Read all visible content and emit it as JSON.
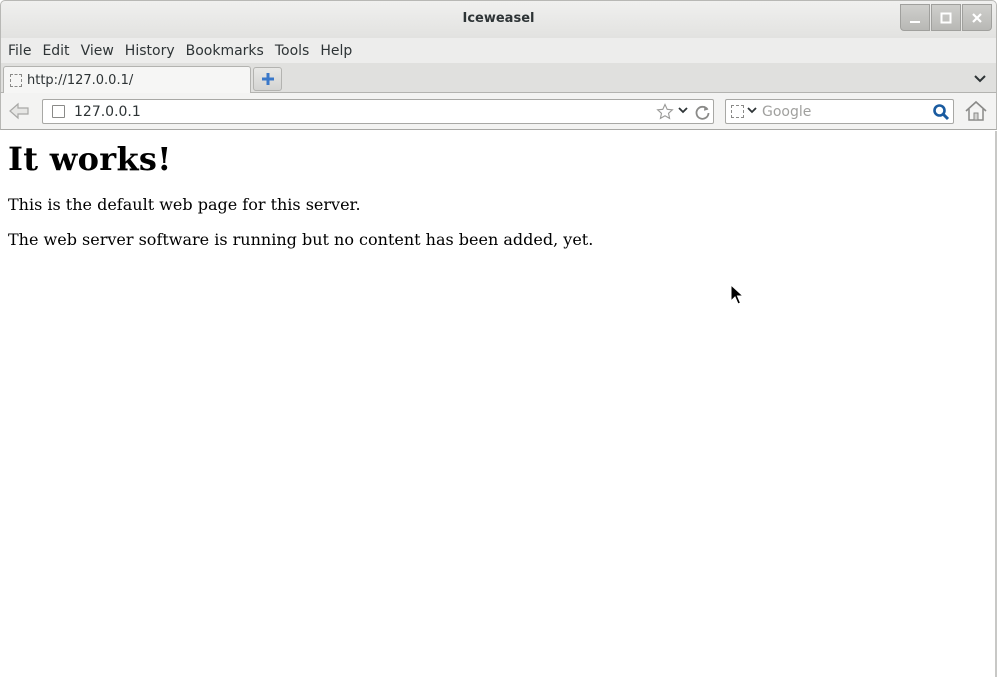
{
  "window": {
    "title": "Iceweasel",
    "controls": {
      "minimize": "minimize-icon",
      "maximize": "maximize-icon",
      "close": "close-icon"
    }
  },
  "menubar": {
    "items": [
      "File",
      "Edit",
      "View",
      "History",
      "Bookmarks",
      "Tools",
      "Help"
    ]
  },
  "tabs": [
    {
      "title": "http://127.0.0.1/",
      "active": true
    }
  ],
  "navbar": {
    "url": "127.0.0.1",
    "search_placeholder": "Google",
    "search_value": ""
  },
  "page": {
    "heading": "It works!",
    "paragraphs": [
      "This is the default web page for this server.",
      "The web server software is running but no content has been added, yet."
    ]
  },
  "colors": {
    "chrome_bg": "#ededec",
    "titlebar_bg": "#e2e2e0",
    "search_go": "#1a5ba0",
    "newtab_plus": "#3a78c9"
  }
}
